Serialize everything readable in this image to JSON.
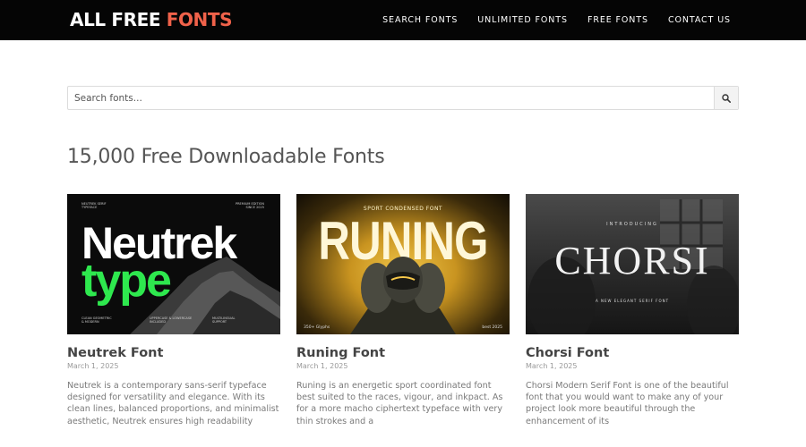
{
  "header": {
    "logo_part1": "ALL FREE ",
    "logo_part2": "FONTS",
    "nav": [
      "SEARCH FONTS",
      "UNLIMITED FONTS",
      "FREE FONTS",
      "CONTACT US"
    ]
  },
  "search": {
    "placeholder": "Search fonts..."
  },
  "page_title": "15,000 Free Downloadable Fonts",
  "cards": [
    {
      "title": "Neutrek Font",
      "date": "March 1, 2025",
      "description": "Neutrek is a contemporary sans-serif typeface designed for versatility and elegance. With its clean lines, balanced proportions, and minimalist aesthetic, Neutrek ensures high readability across various mediums. Whether",
      "thumb": {
        "line1": "Neutrek",
        "line2": "type"
      }
    },
    {
      "title": "Runing Font",
      "date": "March 1, 2025",
      "description": "Runing is an energetic sport coordinated font best suited to the races, vigour, and inkpact. As for a more macho ciphertext typeface with very thin strokes and a",
      "thumb": {
        "subtitle": "SPORT CONDENSED FONT",
        "word": "RUNING",
        "foot_left": "350+ Glyphs",
        "foot_right": "best 2025"
      }
    },
    {
      "title": "Chorsi Font",
      "date": "March 1, 2025",
      "description": "Chorsi Modern Serif Font is one of the beautiful font that you would want to make any of your project look more beautiful through the enhancement of its",
      "thumb": {
        "subtitle": "INTRODUCING",
        "word": "CHORSI",
        "tagline": "A NEW ELEGANT SERIF FONT"
      }
    }
  ],
  "colors": {
    "logo_accent": "#f0624a",
    "neutrek_green": "#2ee84e",
    "header_bg": "#050505"
  },
  "icons": {
    "search_button": "search-icon"
  }
}
